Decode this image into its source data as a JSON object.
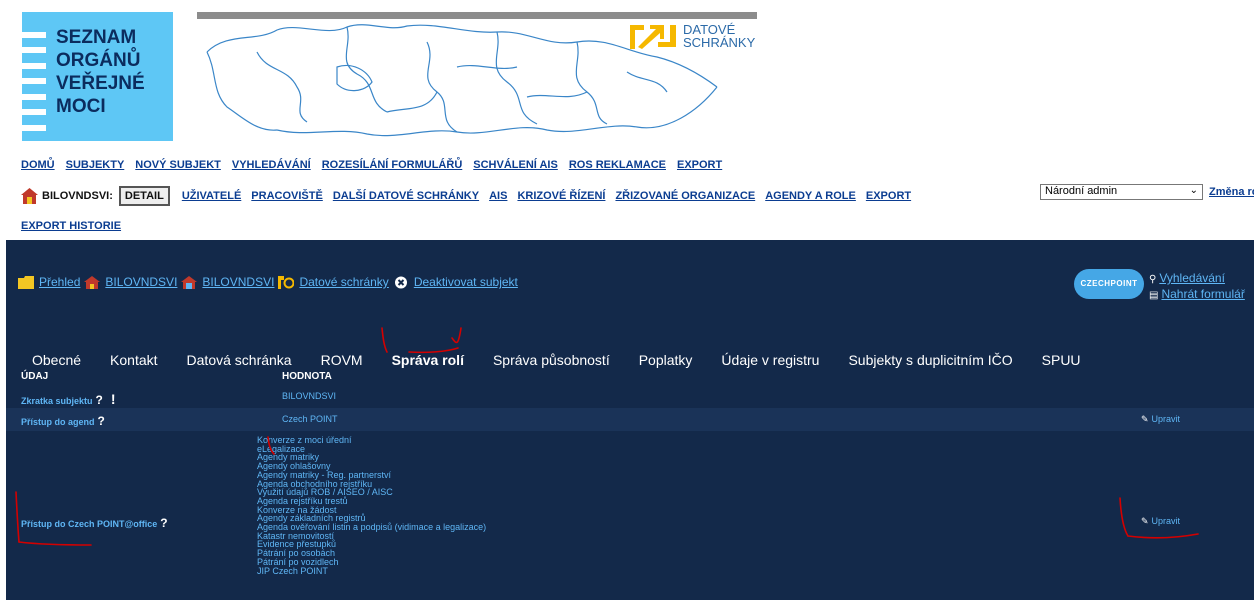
{
  "logo": {
    "lines": [
      "SEZNAM",
      "ORGÁNŮ",
      "VEŘEJNÉ",
      "MOCI"
    ]
  },
  "datove_schranky": {
    "line1": "DATOVÉ",
    "line2": "SCHRÁNKY"
  },
  "nav1": [
    "DOMŮ",
    "SUBJEKTY",
    "NOVÝ SUBJEKT",
    "VYHLEDÁVÁNÍ",
    "ROZESÍLÁNÍ FORMULÁŘŮ",
    "SCHVÁLENÍ AIS",
    "ROS REKLAMACE",
    "EXPORT"
  ],
  "nav2": {
    "subject": "BILOVNDSVI:",
    "detail": "DETAIL",
    "links": [
      "UŽIVATELÉ",
      "PRACOVIŠTĚ",
      "DALŠÍ DATOVÉ SCHRÁNKY",
      "AIS",
      "KRIZOVÉ ŘÍZENÍ",
      "ZŘIZOVANÉ ORGANIZACE",
      "AGENDY A ROLE",
      "EXPORT"
    ]
  },
  "role_select": {
    "value": "Národní admin"
  },
  "zmena_link": "Změna ro",
  "export_history": "EXPORT HISTORIE",
  "linkbar": {
    "prehled": "Přehled",
    "subject1": "BILOVNDSVI",
    "subject2": "BILOVNDSVI",
    "datove": "Datové schránky",
    "deactivate": "Deaktivovat subjekt"
  },
  "czech_point": {
    "badge": "CZECHPOINT",
    "search": "Vyhledávání",
    "upload": "Nahrát formulář"
  },
  "tabs": [
    "Obecné",
    "Kontakt",
    "Datová schránka",
    "ROVM",
    "Správa rolí",
    "Správa působností",
    "Poplatky",
    "Údaje v registru",
    "Subjekty s duplicitním IČO",
    "SPUU"
  ],
  "active_tab": "Správa rolí",
  "table": {
    "col1": "ÚDAJ",
    "col2": "HODNOTA",
    "rows": [
      {
        "label": "Zkratka subjektu",
        "value": "BILOVNDSVI"
      },
      {
        "label": "Přístup do agend",
        "value": "Czech POINT",
        "edit": "Upravit"
      },
      {
        "label": "Přístup do Czech POINT@office",
        "edit": "Upravit"
      }
    ]
  },
  "agendas": [
    "Konverze z moci úřední",
    "eLegalizace",
    "Agendy matriky",
    "Agendy ohlašovny",
    "Agendy matriky - Reg. partnerství",
    "Agenda obchodního rejstříku",
    "Využití údajů ROB / AISEO / AISC",
    "Agenda rejstříku trestů",
    "Konverze na žádost",
    "Agendy základních registrů",
    "Agenda ověřování listin a podpisů (vidimace a legalizace)",
    "Katastr nemovitostí",
    "Evidence přestupků",
    "Pátrání po osobách",
    "Pátrání po vozidlech",
    "JIP Czech POINT"
  ],
  "colors": {
    "dark_bg": "#13294a",
    "link_light": "#5fb6f5",
    "logo_blue": "#5ec7f5",
    "annotation_red": "#d40000"
  }
}
